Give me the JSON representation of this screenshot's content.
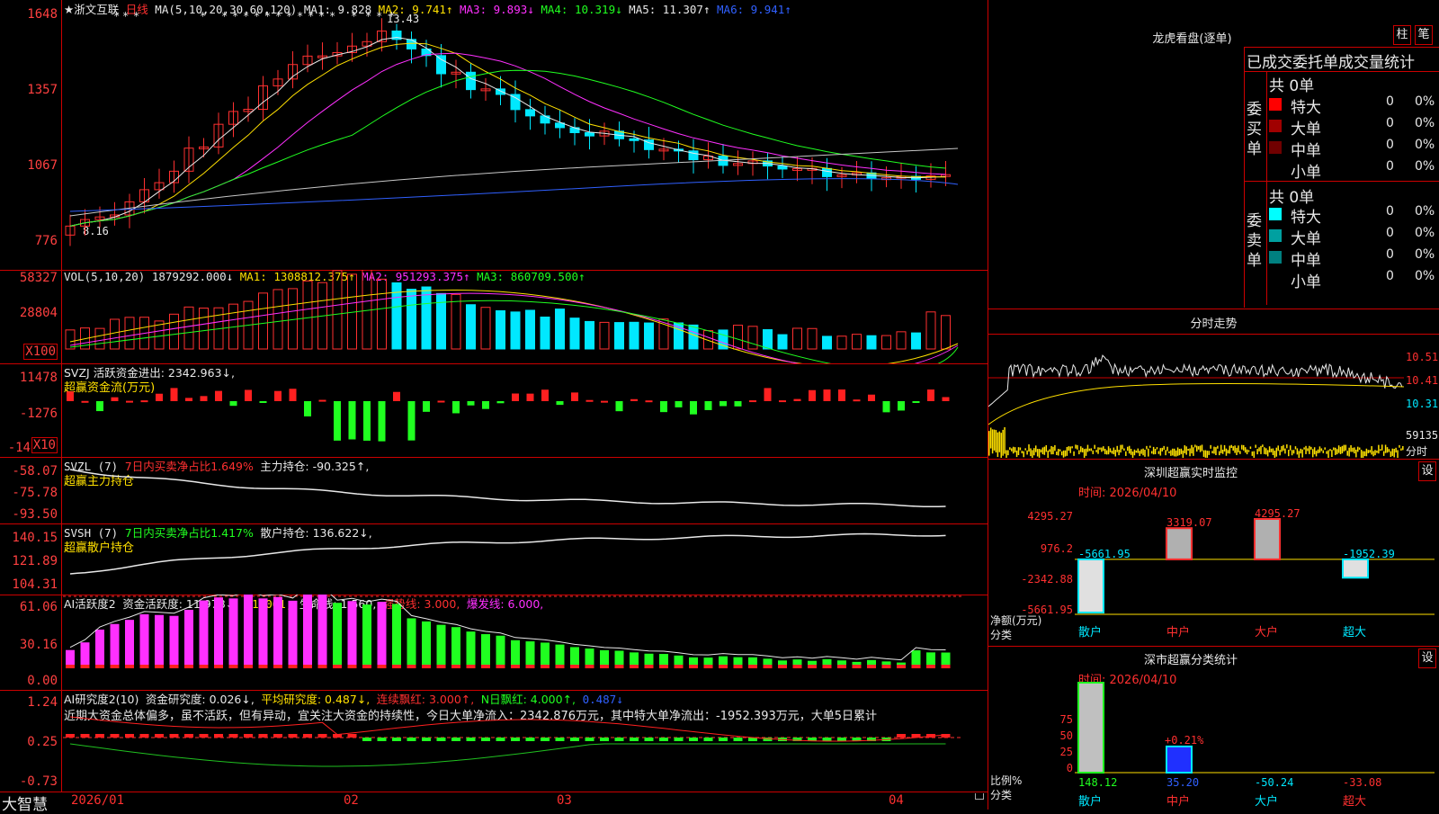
{
  "header": {
    "stock_name": "★浙文互联",
    "period": "日线",
    "ma_label": "MA(5,10,20,30,60,120)",
    "ma1": "MA1: 9.828",
    "ma2": "MA2: 9.741↑",
    "ma3": "MA3: 9.893↓",
    "ma4": "MA4: 10.319↓",
    "ma5": "MA5: 11.307↑",
    "ma6": "MA6: 9.941↑",
    "high_mark": "13.43",
    "low_mark": "8.16"
  },
  "price_axis": [
    "1648",
    "1357",
    "1067",
    "776"
  ],
  "vol": {
    "label": "VOL(5,10,20)",
    "value": "1879292.000↓",
    "ma1": "MA1: 1308812.375↑",
    "ma2": "MA2: 951293.375↑",
    "ma3": "MA3: 860709.500↑",
    "axis": [
      "58327",
      "28804",
      "X100"
    ]
  },
  "svzj": {
    "label": "SVZJ  活跃资金进出: 2342.963↓,",
    "sub": "超赢资金流(万元)",
    "axis": [
      "11478",
      "-1276",
      "-14",
      "X10"
    ]
  },
  "svzl": {
    "label": "SVZL (7)",
    "ratio": "7日内买卖净占比1.649%",
    "hold": "主力持仓: -90.325↑,",
    "sub": "超赢主力持仓",
    "axis": [
      "-58.07",
      "-75.78",
      "-93.50"
    ]
  },
  "svsh": {
    "label": "SVSH (7)",
    "ratio": "7日内买卖净占比1.417%",
    "hold": "散户持仓: 136.622↓,",
    "sub": "超赢散户持仓",
    "axis": [
      "140.15",
      "121.89",
      "104.31"
    ]
  },
  "ai_active": {
    "label": "AI活跃度2",
    "v1": "资金活跃度: 11.978↓,",
    "v2": "61.061,",
    "v3": "生命线: 1.560,",
    "v4": "强势线: 3.000,",
    "v5": "爆发线: 6.000,",
    "axis": [
      "61.06",
      "30.16",
      "0.00"
    ]
  },
  "ai_research": {
    "label": "AI研究度2(10)",
    "v1": "资金研究度: 0.026↓,",
    "v2": "平均研究度: 0.487↓,",
    "v3": "连续飘红: 3.000↑,",
    "v4": "N日飘红: 4.000↑,",
    "v5": "0.487↓",
    "comment": "近期大资金总体偏多，虽不活跃，但有异动，宜关注大资金的持续性，今日大单净流入：2342.876万元，其中特大单净流出：-1952.393万元，大单5日累计",
    "axis": [
      "1.24",
      "0.25",
      "-0.73"
    ]
  },
  "date_axis": [
    "2026/01",
    "02",
    "03",
    "04"
  ],
  "brand": "大智慧",
  "dragon": {
    "title": "龙虎看盘(逐单)",
    "btn1": "柱",
    "btn2": "笔",
    "table_title": "已成交委托单成交量统计",
    "buy_label": "委买单",
    "sell_label": "委卖单",
    "buy_total": "共 0单",
    "sell_total": "共 0单",
    "buy_rows": [
      {
        "name": "特大",
        "count": "0",
        "pct": "0%",
        "color": "#ff0000"
      },
      {
        "name": "大单",
        "count": "0",
        "pct": "0%",
        "color": "#a00000"
      },
      {
        "name": "中单",
        "count": "0",
        "pct": "0%",
        "color": "#700000"
      },
      {
        "name": "小单",
        "count": "0",
        "pct": "0%",
        "color": ""
      }
    ],
    "sell_rows": [
      {
        "name": "特大",
        "count": "0",
        "pct": "0%",
        "color": "#00ffff"
      },
      {
        "name": "大单",
        "count": "0",
        "pct": "0%",
        "color": "#00a0a0"
      },
      {
        "name": "中单",
        "count": "0",
        "pct": "0%",
        "color": "#008080"
      },
      {
        "name": "小单",
        "count": "0",
        "pct": "0%",
        "color": ""
      }
    ]
  },
  "intraday": {
    "title": "分时走势",
    "axis": [
      "10.51",
      "10.41",
      "10.31"
    ],
    "vol_label": "59135",
    "foot": "分时"
  },
  "sz_monitor": {
    "title": "深圳超赢实时监控",
    "btn": "设",
    "time": "时间: 2026/04/10",
    "axis": [
      "4295.27",
      "976.2",
      "-2342.88",
      "-5661.95"
    ],
    "unit": "净额(万元)",
    "cat_label": "分类",
    "bars": [
      {
        "cat": "散户",
        "value": -5661.95,
        "label": "-5661.95",
        "cat_color": "#00e8ff"
      },
      {
        "cat": "中户",
        "value": 3319.07,
        "label": "3319.07",
        "cat_color": "#ff3030"
      },
      {
        "cat": "大户",
        "value": 4295.27,
        "label": "4295.27",
        "cat_color": "#ff3030"
      },
      {
        "cat": "超大",
        "value": -1952.39,
        "label": "-1952.39",
        "cat_color": "#00e8ff"
      }
    ]
  },
  "sz_class": {
    "title": "深市超赢分类统计",
    "btn": "设",
    "time": "时间: 2026/04/10",
    "axis": [
      "75",
      "50",
      "25",
      "0"
    ],
    "unit": "比例%",
    "cat_label": "分类",
    "annot": "+0.21%",
    "cats": [
      {
        "cat": "散户",
        "value": "148.12",
        "cat_color": "#00e8ff",
        "val_color": "#20ff20"
      },
      {
        "cat": "中户",
        "value": "35.20",
        "cat_color": "#ff3030",
        "val_color": "#3060ff"
      },
      {
        "cat": "大户",
        "value": "-50.24",
        "cat_color": "#00e8ff",
        "val_color": "#00e8ff"
      },
      {
        "cat": "超大",
        "value": "-33.08",
        "cat_color": "#ff3030",
        "val_color": "#ff3030"
      }
    ]
  }
}
